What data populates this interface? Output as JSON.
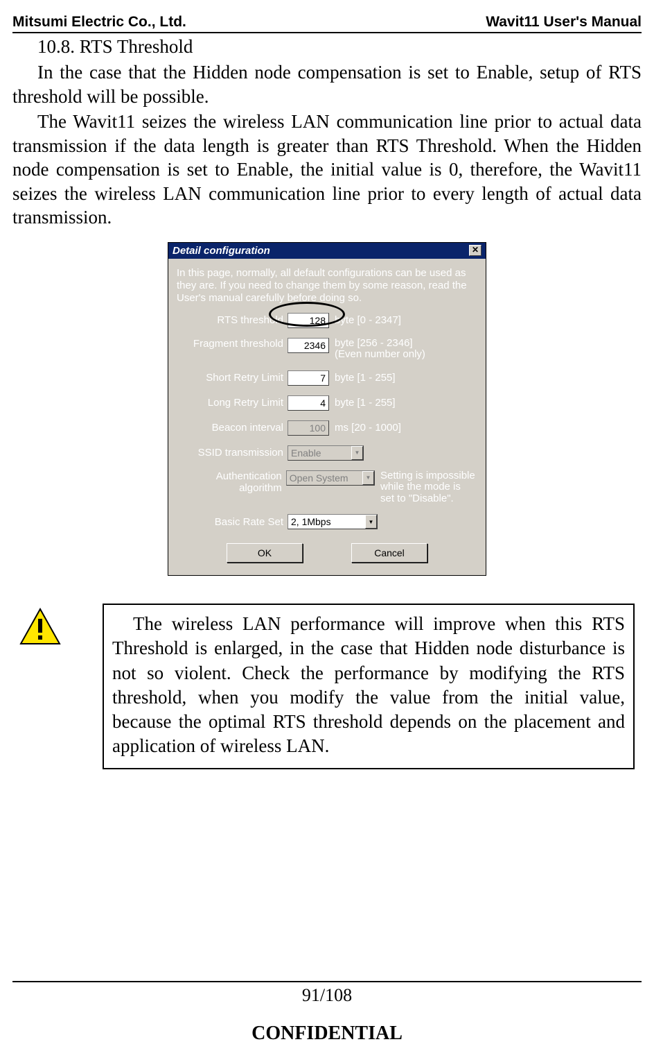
{
  "header": {
    "left": "Mitsumi Electric Co., Ltd.",
    "right": "Wavit11 User's Manual"
  },
  "section": {
    "number_title": "10.8. RTS Threshold",
    "para1": "In the case that the Hidden node compensation is set to Enable, setup of RTS threshold will be possible.",
    "para2": "The Wavit11 seizes the wireless LAN communication line prior to actual data transmission if the data length is greater than RTS Threshold. When the Hidden node compensation is set to Enable, the initial value is 0, therefore, the Wavit11 seizes the wireless LAN communication line prior to every length of actual data transmission."
  },
  "dialog": {
    "title": "Detail configuration",
    "close": "✕",
    "intro": "In this page, normally, all default configurations can be used as they are. If you need to change them by some reason, read the User's manual carefully before doing so.",
    "rows": {
      "rts": {
        "label": "RTS threshold",
        "value": "128",
        "hint": "byte [0 - 2347]"
      },
      "frag": {
        "label": "Fragment threshold",
        "value": "2346",
        "hint": "byte [256 - 2346]\n(Even number only)"
      },
      "short": {
        "label": "Short Retry Limit",
        "value": "7",
        "hint": "byte [1 - 255]"
      },
      "long": {
        "label": "Long Retry Limit",
        "value": "4",
        "hint": "byte [1 - 255]"
      },
      "beacon": {
        "label": "Beacon interval",
        "value": "100",
        "hint": "ms [20 - 1000]"
      },
      "ssid": {
        "label": "SSID transmission",
        "value": "Enable",
        "hint": ""
      },
      "auth": {
        "label": "Authentication\nalgorithm",
        "value": "Open System",
        "hint": "Setting is impossible while the mode is set to \"Disable\"."
      },
      "rate": {
        "label": "Basic Rate Set",
        "value": "2, 1Mbps",
        "hint": ""
      }
    },
    "buttons": {
      "ok": "OK",
      "cancel": "Cancel"
    }
  },
  "note": {
    "text": "The wireless LAN performance will improve when this RTS Threshold is enlarged, in the case that Hidden node disturbance is not so violent. Check the performance by modifying the RTS threshold, when you modify the value from the initial value, because the optimal RTS  threshold depends on the placement and application of wireless LAN."
  },
  "footer": {
    "page": "91/108",
    "confidential": "CONFIDENTIAL"
  }
}
